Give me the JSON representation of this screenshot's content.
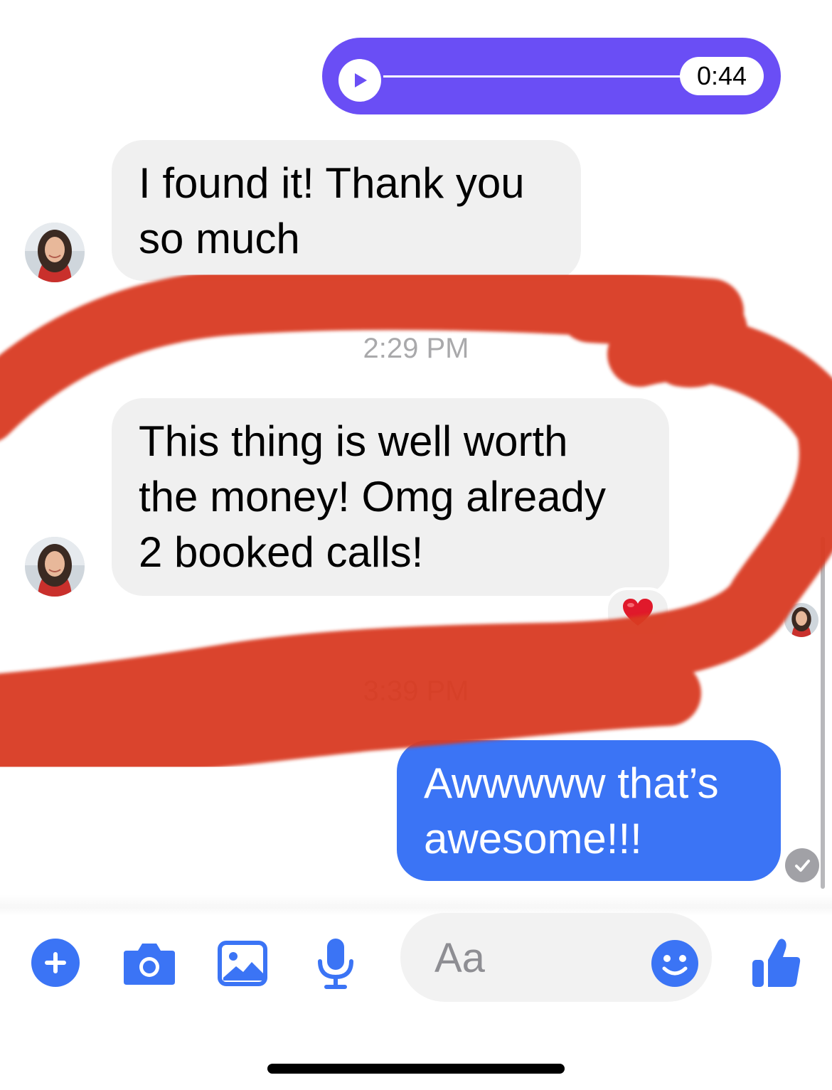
{
  "voice_message": {
    "duration": "0:44",
    "progress": 0,
    "color": "#6a4ef5"
  },
  "messages": [
    {
      "direction": "incoming",
      "lines": [
        "I found it! Thank you",
        "so much"
      ]
    },
    {
      "direction": "incoming",
      "lines": [
        "This thing is well worth",
        "the money! Omg already",
        "2 booked calls!"
      ],
      "reaction": "heart-icon"
    },
    {
      "direction": "outgoing",
      "lines": [
        "Awwwww that’s",
        "awesome!!!"
      ],
      "status": "delivered-check-icon"
    }
  ],
  "timestamps": [
    "2:29 PM",
    "3:39 PM"
  ],
  "composer": {
    "placeholder": "Aa",
    "icons": [
      "plus-icon",
      "camera-icon",
      "gallery-icon",
      "microphone-icon",
      "emoji-icon",
      "thumbs-up-icon"
    ]
  },
  "colors": {
    "accent": "#3b74f5",
    "incoming_bubble": "#f0f0f0",
    "annotation_marker": "#d93a22"
  }
}
